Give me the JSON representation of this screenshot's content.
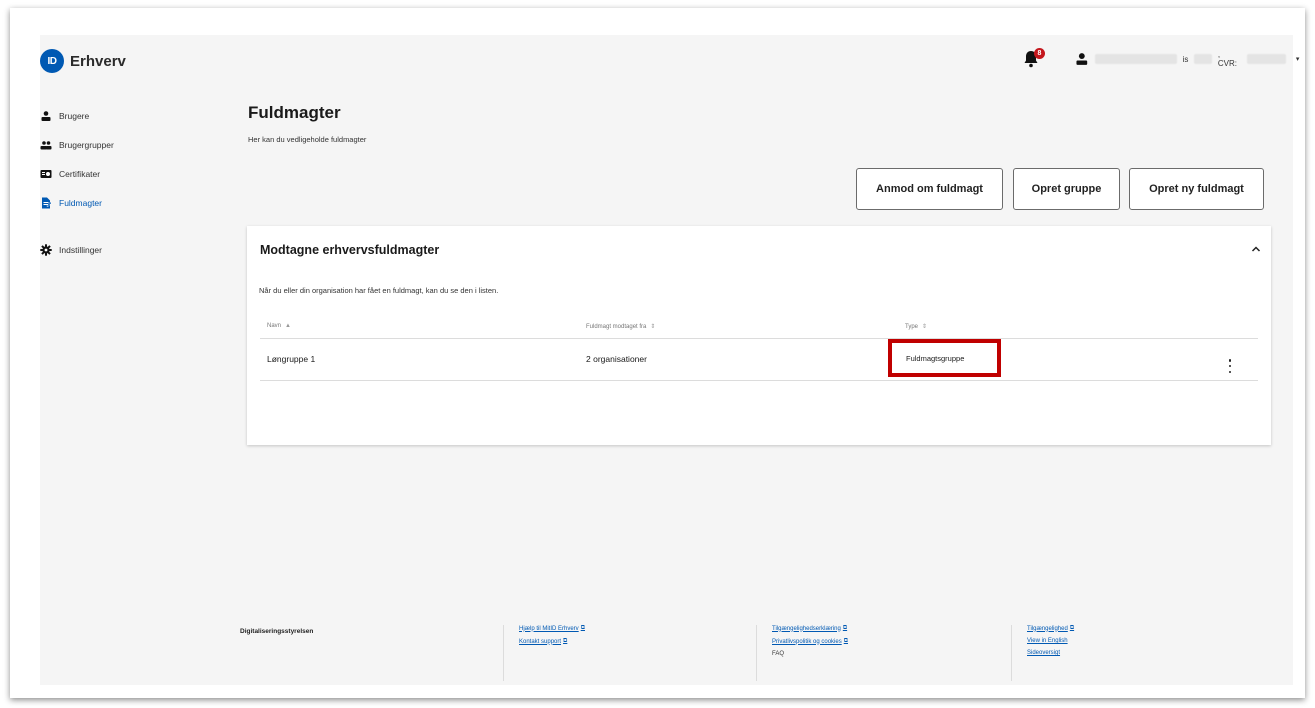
{
  "brand": {
    "logo_text": "ID",
    "name": "Erhverv"
  },
  "header": {
    "notification_count": "8",
    "user_suffix": "is",
    "cvr_label": ", CVR:",
    "caret": "▾"
  },
  "sidebar": {
    "items": [
      {
        "label": "Brugere",
        "icon": "user-icon"
      },
      {
        "label": "Brugergrupper",
        "icon": "users-icon"
      },
      {
        "label": "Certifikater",
        "icon": "certificate-icon"
      },
      {
        "label": "Fuldmagter",
        "icon": "document-icon",
        "active": true
      }
    ],
    "settings_label": "Indstillinger"
  },
  "main": {
    "title": "Fuldmagter",
    "subtitle": "Her kan du vedligeholde fuldmagter",
    "buttons": {
      "anmod": "Anmod om fuldmagt",
      "opret_gruppe": "Opret gruppe",
      "opret_ny": "Opret ny fuldmagt"
    },
    "card": {
      "title": "Modtagne erhvervsfuldmagter",
      "description": "Når du eller din organisation har fået en fuldmagt, kan du se den i listen.",
      "columns": [
        {
          "label": "Navn",
          "sort": "▲"
        },
        {
          "label": "Fuldmagt modtaget fra",
          "sort": "⇕"
        },
        {
          "label": "Type",
          "sort": "⇕"
        }
      ],
      "rows": [
        {
          "navn": "Løngruppe 1",
          "fra": "2 organisationer",
          "type": "Fuldmagtsgruppe"
        }
      ]
    }
  },
  "footer": {
    "org": "Digitaliseringsstyrelsen",
    "col1": [
      "Hjælp til MitID Erhverv",
      "Kontakt support"
    ],
    "col2": [
      "Tilgængelighedserklæring",
      "Privatlivspolitik og cookies",
      "FAQ"
    ],
    "col3": [
      "Tilgængelighed",
      "View in English",
      "Sideoversigt"
    ],
    "ext_icon": "⧉"
  },
  "colors": {
    "accent": "#0059b3",
    "highlight": "#c00000",
    "badge": "#c4161c"
  }
}
